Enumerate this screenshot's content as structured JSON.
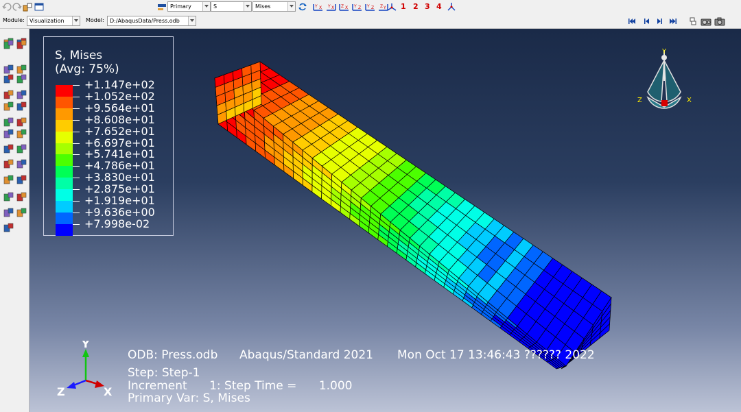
{
  "toolbar": {
    "primary_label": "Primary",
    "field": "S",
    "invariant": "Mises",
    "axis_numbers": [
      "1",
      "2",
      "3",
      "4"
    ]
  },
  "context": {
    "module_label": "Module:",
    "module_value": "Visualization",
    "model_label": "Model:",
    "model_value": "D:/AbaqusData/Press.odb"
  },
  "legend": {
    "title": "S, Mises\n(Avg: 75%)",
    "values": [
      "+1.147e+02",
      "+1.052e+02",
      "+9.564e+01",
      "+8.608e+01",
      "+7.652e+01",
      "+6.697e+01",
      "+5.741e+01",
      "+4.786e+01",
      "+3.830e+01",
      "+2.875e+01",
      "+1.919e+01",
      "+9.636e+00",
      "+7.998e-02"
    ],
    "colors": [
      "#ff0000",
      "#ff5500",
      "#ff9900",
      "#ffcc00",
      "#e6ff00",
      "#a6ff00",
      "#4cff00",
      "#00ff55",
      "#00ffa6",
      "#00ffe6",
      "#00ccff",
      "#0066ff",
      "#0000ff"
    ]
  },
  "triad": {
    "x": "X",
    "y": "Y",
    "z": "Z"
  },
  "info": {
    "odb": "ODB: Press.odb",
    "solver": "Abaqus/Standard 2021",
    "date": "Mon Oct 17 13:46:43 ?????? 2022",
    "step": "Step: Step-1",
    "increment": "Increment      1: Step Time =      1.000",
    "primary_var": "Primary Var: S, Mises"
  },
  "colors": {
    "viewport_top": "#1a2a48",
    "viewport_bottom": "#bcc3d6",
    "axis_red": "#d00000"
  }
}
